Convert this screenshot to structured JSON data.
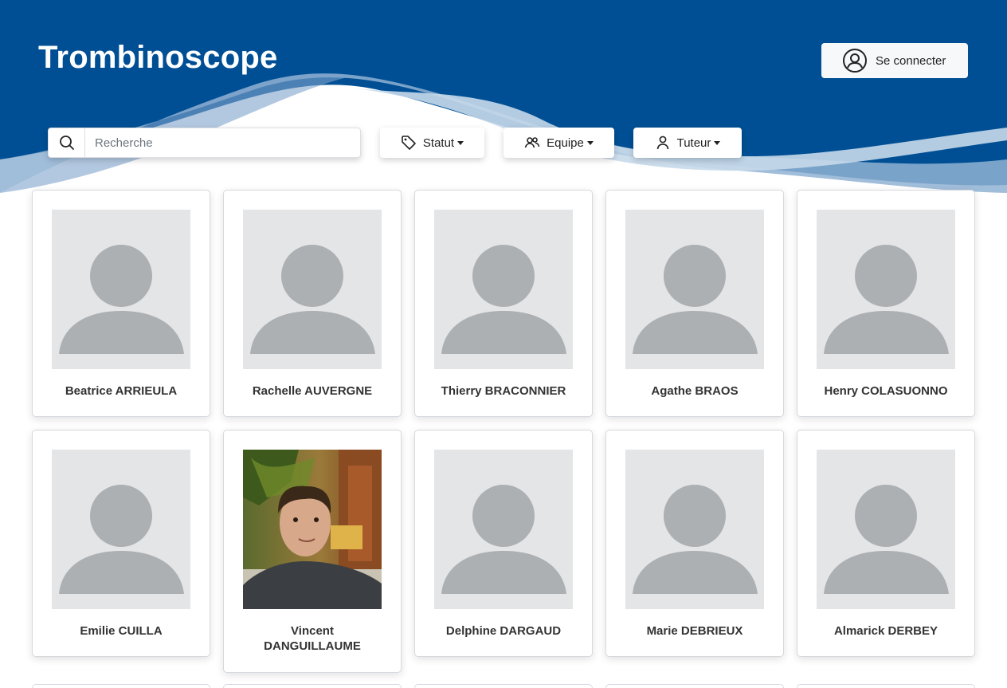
{
  "header": {
    "title": "Trombinoscope",
    "login_label": "Se connecter",
    "colors": {
      "primary": "#004f94",
      "wave_light": "#9ab8d8",
      "wave_lighter": "#c6d9ea"
    }
  },
  "search": {
    "placeholder": "Recherche",
    "value": ""
  },
  "filters": [
    {
      "label": "Statut",
      "icon": "tag-icon"
    },
    {
      "label": "Equipe",
      "icon": "users-icon"
    },
    {
      "label": "Tuteur",
      "icon": "user-icon"
    }
  ],
  "people": [
    {
      "name": "Beatrice ARRIEULA",
      "photo": "placeholder"
    },
    {
      "name": "Rachelle AUVERGNE",
      "photo": "placeholder"
    },
    {
      "name": "Thierry BRACONNIER",
      "photo": "placeholder"
    },
    {
      "name": "Agathe BRAOS",
      "photo": "placeholder"
    },
    {
      "name": "Henry COLASUONNO",
      "photo": "placeholder"
    },
    {
      "name": "Emilie CUILLA",
      "photo": "placeholder"
    },
    {
      "name": "Vincent DANGUILLAUME",
      "photo": "portrait"
    },
    {
      "name": "Delphine DARGAUD",
      "photo": "placeholder"
    },
    {
      "name": "Marie DEBRIEUX",
      "photo": "placeholder"
    },
    {
      "name": "Almarick DERBEY",
      "photo": "placeholder"
    }
  ]
}
